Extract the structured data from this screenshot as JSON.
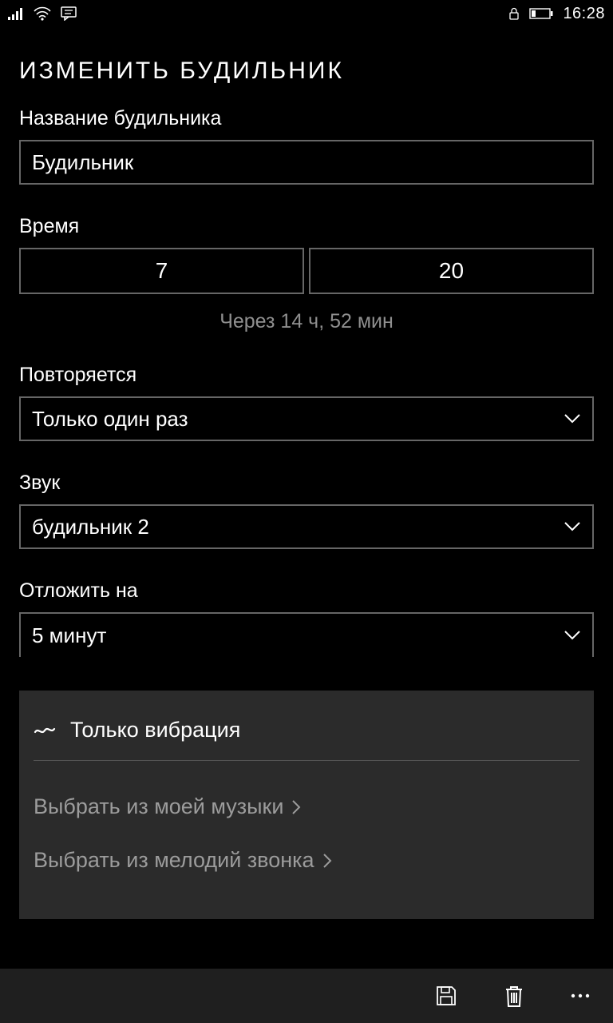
{
  "status": {
    "time": "16:28"
  },
  "page": {
    "title": "ИЗМЕНИТЬ БУДИЛЬНИК"
  },
  "name_field": {
    "label": "Название будильника",
    "value": "Будильник"
  },
  "time_field": {
    "label": "Время",
    "hours": "7",
    "minutes": "20",
    "remaining": "Через 14 ч, 52 мин"
  },
  "repeat_field": {
    "label": "Повторяется",
    "value": "Только один раз"
  },
  "sound_field": {
    "label": "Звук",
    "value": "будильник 2"
  },
  "snooze_field": {
    "label": "Отложить на",
    "value": "5 минут"
  },
  "sound_menu": {
    "vibrate_only": "Только вибрация",
    "from_music": "Выбрать из моей музыки",
    "from_ringtones": "Выбрать из мелодий звонка"
  }
}
